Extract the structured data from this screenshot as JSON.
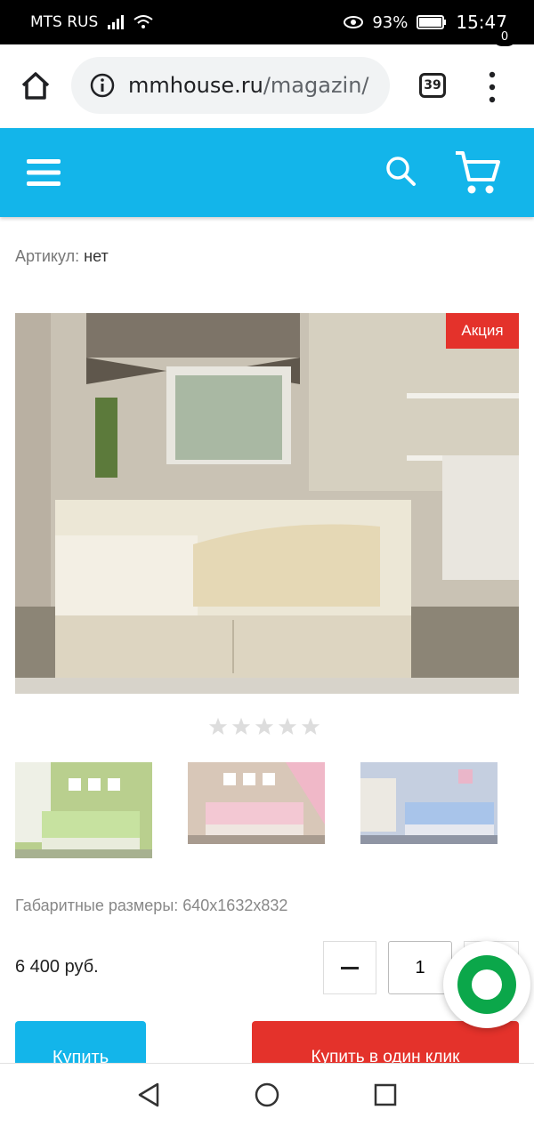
{
  "status_bar": {
    "carrier": "MTS RUS",
    "battery_percent": "93%",
    "time": "15:47",
    "icons": [
      "signal-icon",
      "wifi-icon",
      "eye-icon",
      "battery-icon"
    ]
  },
  "browser": {
    "url_domain": "mmhouse.ru",
    "url_path": "/magazin/",
    "tabs_count": "39",
    "icons": [
      "home-icon",
      "info-icon",
      "tabs-icon",
      "menu-dots-icon"
    ]
  },
  "site_header": {
    "cart_count": "0",
    "icons": [
      "hamburger-icon",
      "search-icon",
      "cart-icon"
    ]
  },
  "product": {
    "article_label": "Артикул:",
    "article_value": "нет",
    "sale_badge": "Акция",
    "rating_stars_filled": 0,
    "rating_stars_total": 5,
    "thumbnails_count": 3,
    "dimensions": "Габаритные размеры: 640x1632x832",
    "price": "6 400 руб.",
    "quantity": "1",
    "buy_label": "Купить",
    "one_click_label": "Купить в один клик"
  },
  "colors": {
    "header_blue": "#13b5ea",
    "sale_red": "#e4322b",
    "chat_green": "#0ba74a"
  },
  "nav_bar": {
    "icons": [
      "back-triangle-icon",
      "home-circle-icon",
      "recent-square-icon"
    ]
  }
}
